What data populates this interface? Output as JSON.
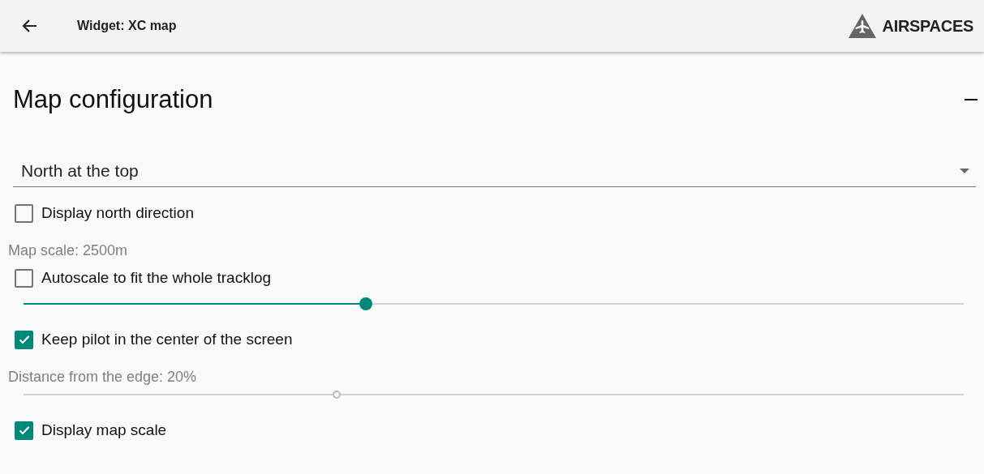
{
  "header": {
    "title": "Widget: XC map",
    "brand": "AIRSPACES"
  },
  "section": {
    "title": "Map configuration",
    "expanded": true
  },
  "dropdown": {
    "value": "North at the top"
  },
  "settings": [
    {
      "kind": "checkbox",
      "label": "Display north direction",
      "checked": false
    },
    {
      "kind": "label",
      "label": "Map scale: 2500m"
    },
    {
      "kind": "checkbox",
      "label": "Autoscale to fit the whole tracklog",
      "checked": false
    },
    {
      "kind": "slider",
      "level": 0.364,
      "disabled": false
    },
    {
      "kind": "checkbox",
      "label": "Keep pilot in the center of the screen",
      "checked": true
    },
    {
      "kind": "label",
      "label": "Distance from the edge: 20%"
    },
    {
      "kind": "slider",
      "level": 0.333,
      "disabled": true
    },
    {
      "kind": "checkbox",
      "label": "Display map scale",
      "checked": true
    }
  ]
}
